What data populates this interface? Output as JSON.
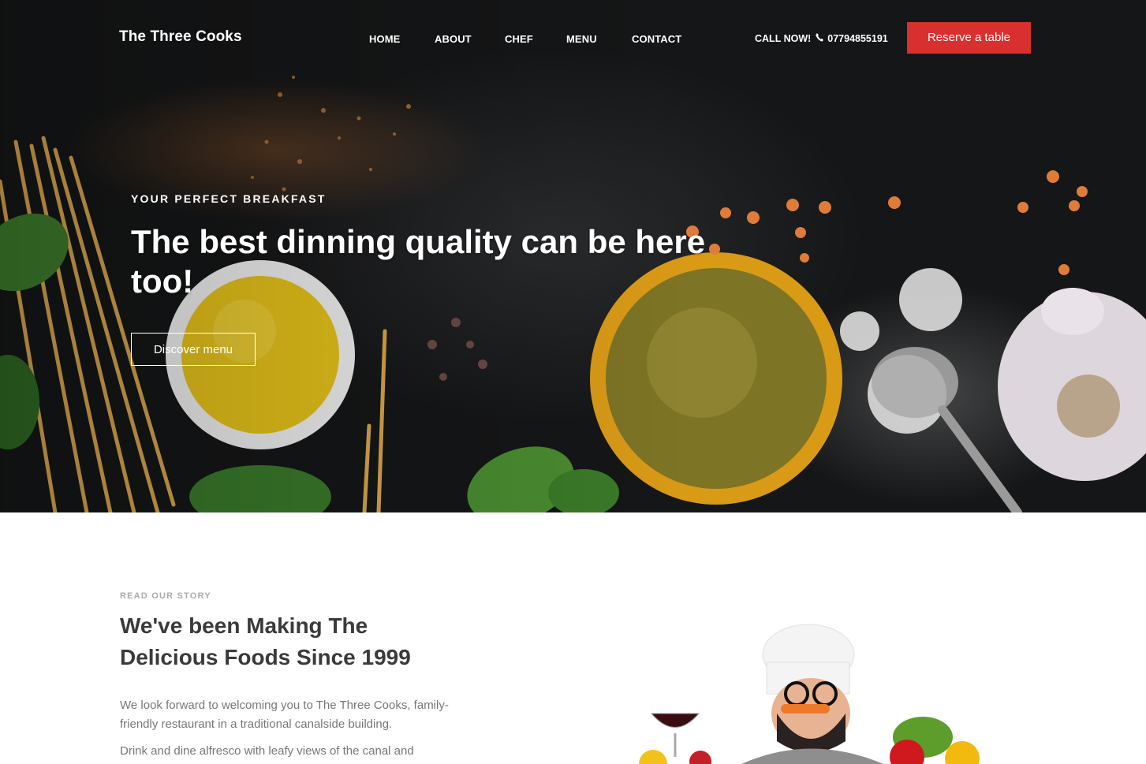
{
  "header": {
    "logo": "The Three Cooks",
    "nav": [
      {
        "label": "HOME"
      },
      {
        "label": "ABOUT"
      },
      {
        "label": "CHEF"
      },
      {
        "label": "MENU"
      },
      {
        "label": "CONTACT"
      }
    ],
    "call_label": "CALL NOW!",
    "phone_icon": "phone-icon",
    "phone_number": "07794855191",
    "reserve_label": "Reserve a table"
  },
  "hero": {
    "eyebrow": "YOUR PERFECT BREAKFAST",
    "headline": "The best dinning quality can be here too!",
    "discover_label": "Discover menu"
  },
  "story": {
    "eyebrow": "READ OUR STORY",
    "title": "We've been Making The Delicious Foods Since 1999",
    "paragraphs": [
      "We look forward to welcoming you to The Three Cooks, family-friendly restaurant in a traditional canalside building.",
      "Drink and dine alfresco with leafy views of the canal and"
    ]
  },
  "colors": {
    "accent": "#d8302f",
    "hero_background": "#151617",
    "heading_text": "#3a3a3a",
    "body_text": "#777777"
  }
}
